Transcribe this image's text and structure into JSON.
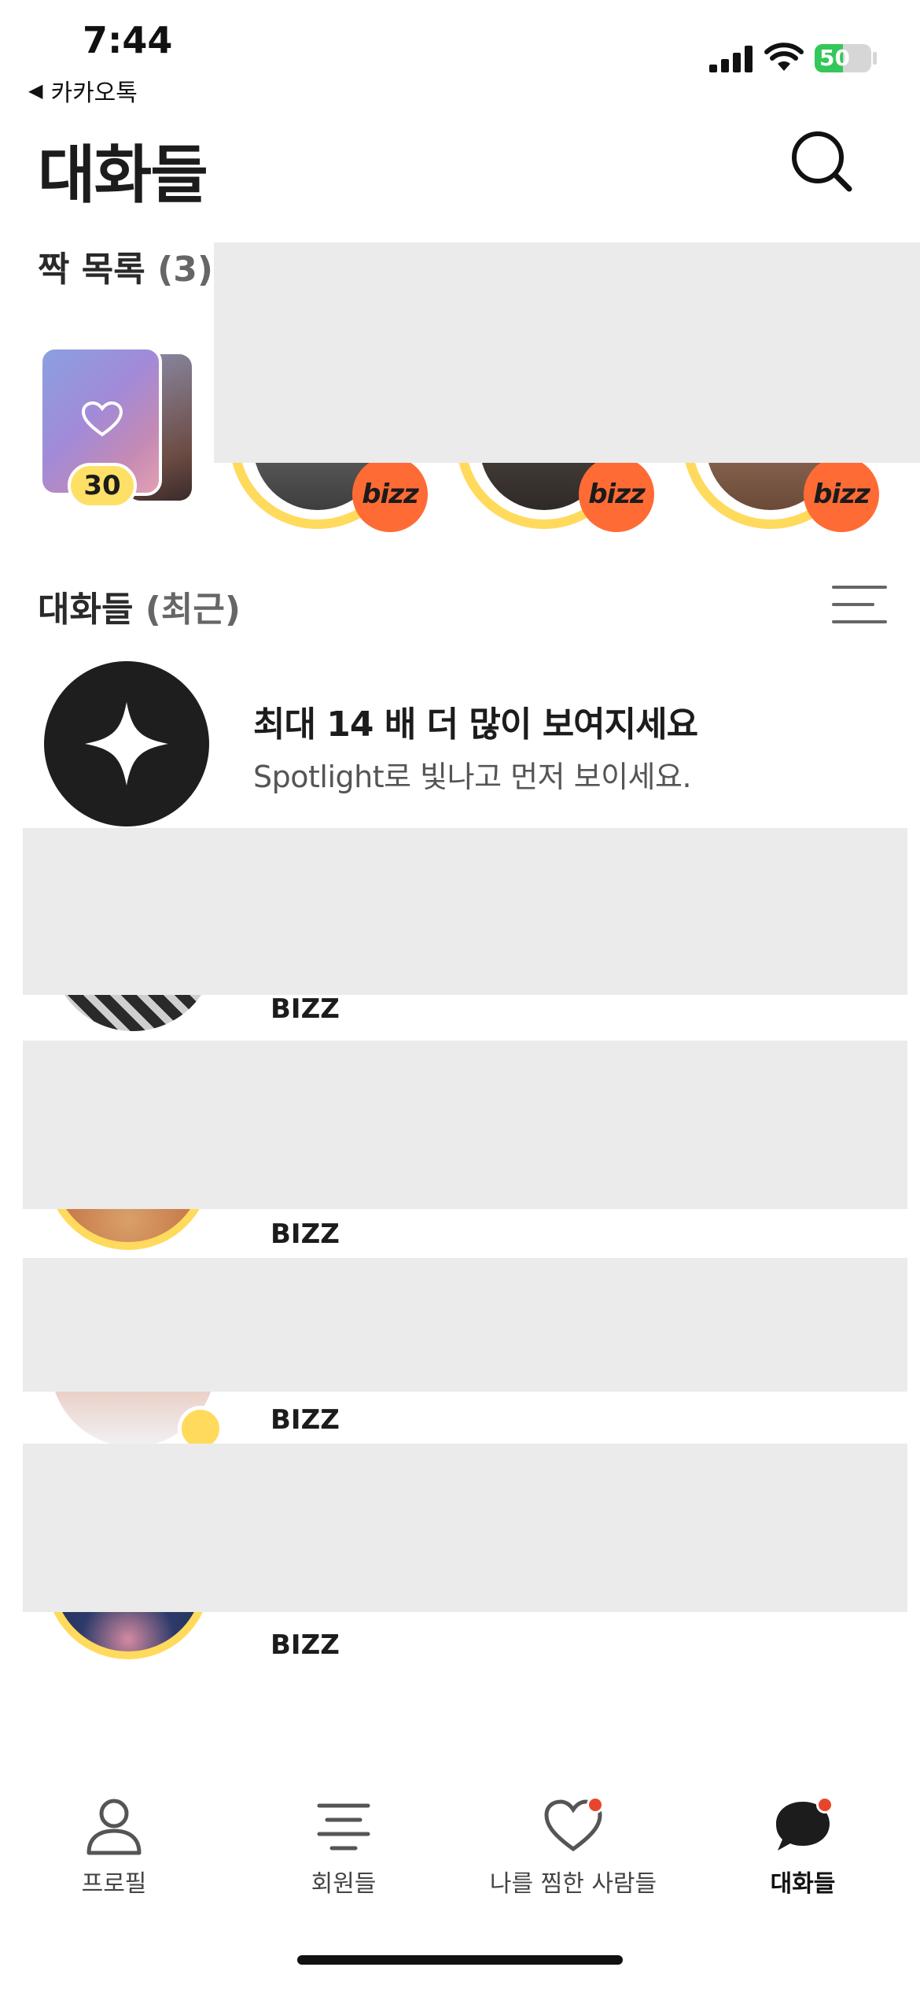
{
  "status_bar": {
    "time": "7:44",
    "back_app": "카카오톡",
    "battery_level": "50",
    "battery_percent": 50
  },
  "header": {
    "title": "대화들"
  },
  "matches": {
    "title_prefix": "짝 목록",
    "count_text": "(3)",
    "likes_count": "30",
    "items": [
      {
        "badge": "bizz"
      },
      {
        "badge": "bizz"
      },
      {
        "badge": "bizz"
      }
    ]
  },
  "conversations": {
    "title_prefix": "대화들",
    "sort_text": "(최근)",
    "spotlight": {
      "title": "최대 14 배 더 많이 보여지세요",
      "subtitle": "Spotlight로 빛나고 먼저 보이세요."
    },
    "rows": [
      {
        "name": "BIZZ"
      },
      {
        "name": "BIZZ"
      },
      {
        "name": "BIZZ"
      },
      {
        "name": "BIZZ"
      }
    ]
  },
  "tab_bar": {
    "tabs": [
      {
        "label": "프로필",
        "icon": "profile-icon"
      },
      {
        "label": "회원들",
        "icon": "members-icon"
      },
      {
        "label": "나를 찜한 사람들",
        "icon": "heart-icon"
      },
      {
        "label": "대화들",
        "icon": "chat-bubble-icon",
        "active": true
      }
    ]
  },
  "colors": {
    "accent_yellow": "#ffda5c",
    "bizz_orange": "#ff6b35",
    "notification_red": "#e8452c",
    "redaction_gray": "#ebebeb"
  }
}
